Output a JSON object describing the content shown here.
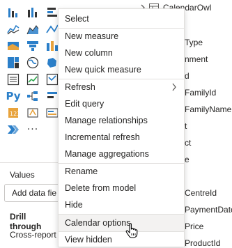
{
  "left_pane": {
    "values_label": "Values",
    "add_field_label": "Add data fie",
    "drill_through_label": "Drill through",
    "cross_report_label": "Cross-report",
    "python_label": "Py",
    "more_visuals": "···"
  },
  "right_pane": {
    "table_name": "CalendarOwl",
    "fields": [
      "Type",
      "nment",
      "d",
      "FamilyId",
      "FamilyName",
      "t",
      "ct",
      "e",
      "CentreId",
      "PaymentDate",
      "Price",
      "ProductId"
    ]
  },
  "context_menu": {
    "items": [
      {
        "label": "Select"
      },
      {
        "label": "New measure"
      },
      {
        "label": "New column"
      },
      {
        "label": "New quick measure"
      },
      {
        "label": "Refresh"
      },
      {
        "label": "Edit query"
      },
      {
        "label": "Manage relationships"
      },
      {
        "label": "Incremental refresh"
      },
      {
        "label": "Manage aggregations"
      },
      {
        "label": "Rename"
      },
      {
        "label": "Delete from model"
      },
      {
        "label": "Hide"
      },
      {
        "label": "Calendar options"
      },
      {
        "label": "View hidden"
      }
    ],
    "hovered_item": "Calendar options"
  },
  "colors": {
    "menu_hover": "#f3f2f1",
    "border": "#e1dfdd",
    "accent_blue": "#2b7fc9",
    "accent_orange": "#e8a33d"
  }
}
